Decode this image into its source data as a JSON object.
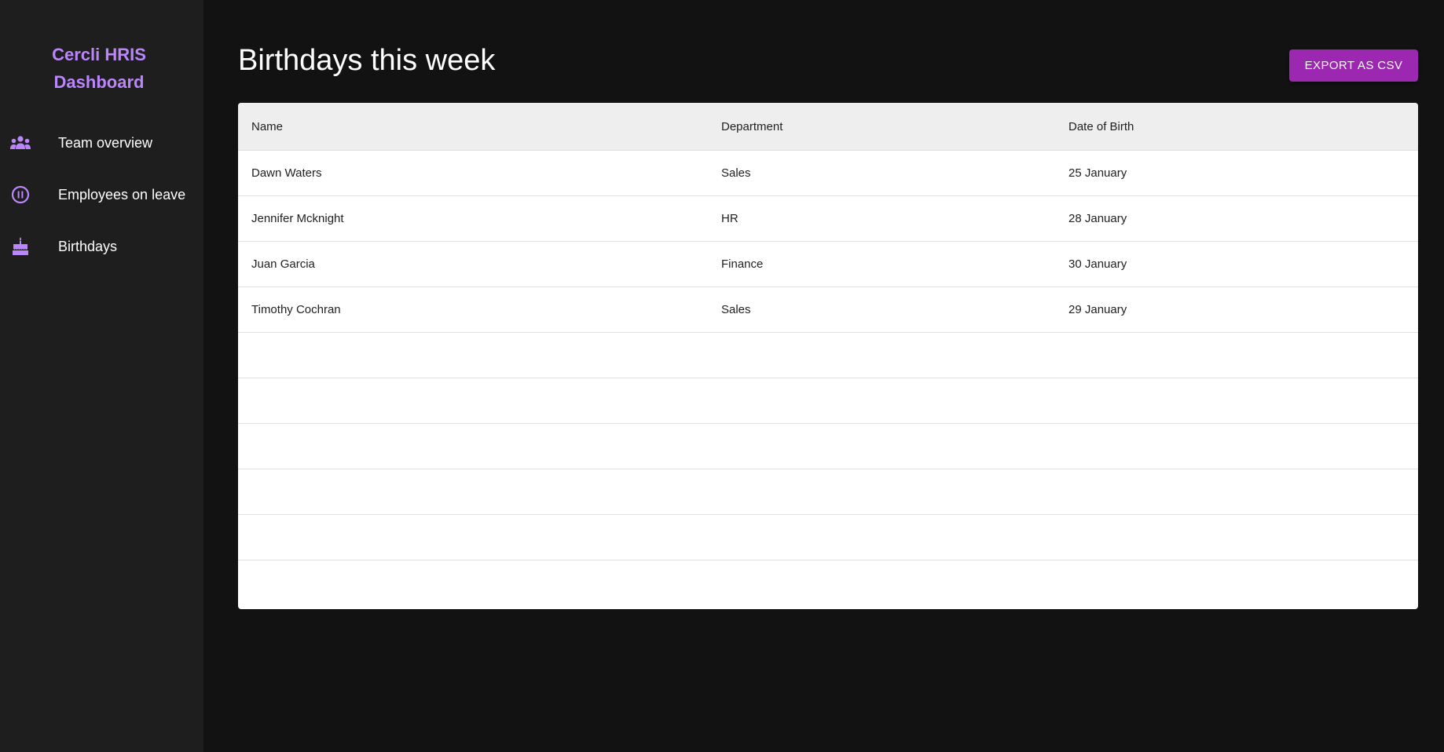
{
  "sidebar": {
    "brand_line1": "Cercli HRIS",
    "brand_line2": "Dashboard",
    "accent_color": "#bb86fc",
    "items": [
      {
        "label": "Team overview",
        "icon": "team-icon"
      },
      {
        "label": "Employees on leave",
        "icon": "pause-circle-icon"
      },
      {
        "label": "Birthdays",
        "icon": "cake-icon"
      }
    ]
  },
  "main": {
    "title": "Birthdays this week",
    "export_label": "EXPORT AS CSV",
    "export_color": "#9c27b0"
  },
  "table": {
    "headers": [
      "Name",
      "Department",
      "Date of Birth"
    ],
    "rows": [
      [
        "Dawn Waters",
        "Sales",
        "25 January"
      ],
      [
        "Jennifer Mcknight",
        "HR",
        "28 January"
      ],
      [
        "Juan Garcia",
        "Finance",
        "30 January"
      ],
      [
        "Timothy Cochran",
        "Sales",
        "29 January"
      ],
      [
        "",
        "",
        ""
      ],
      [
        "",
        "",
        ""
      ],
      [
        "",
        "",
        ""
      ],
      [
        "",
        "",
        ""
      ],
      [
        "",
        "",
        ""
      ],
      [
        "",
        "",
        ""
      ]
    ]
  }
}
